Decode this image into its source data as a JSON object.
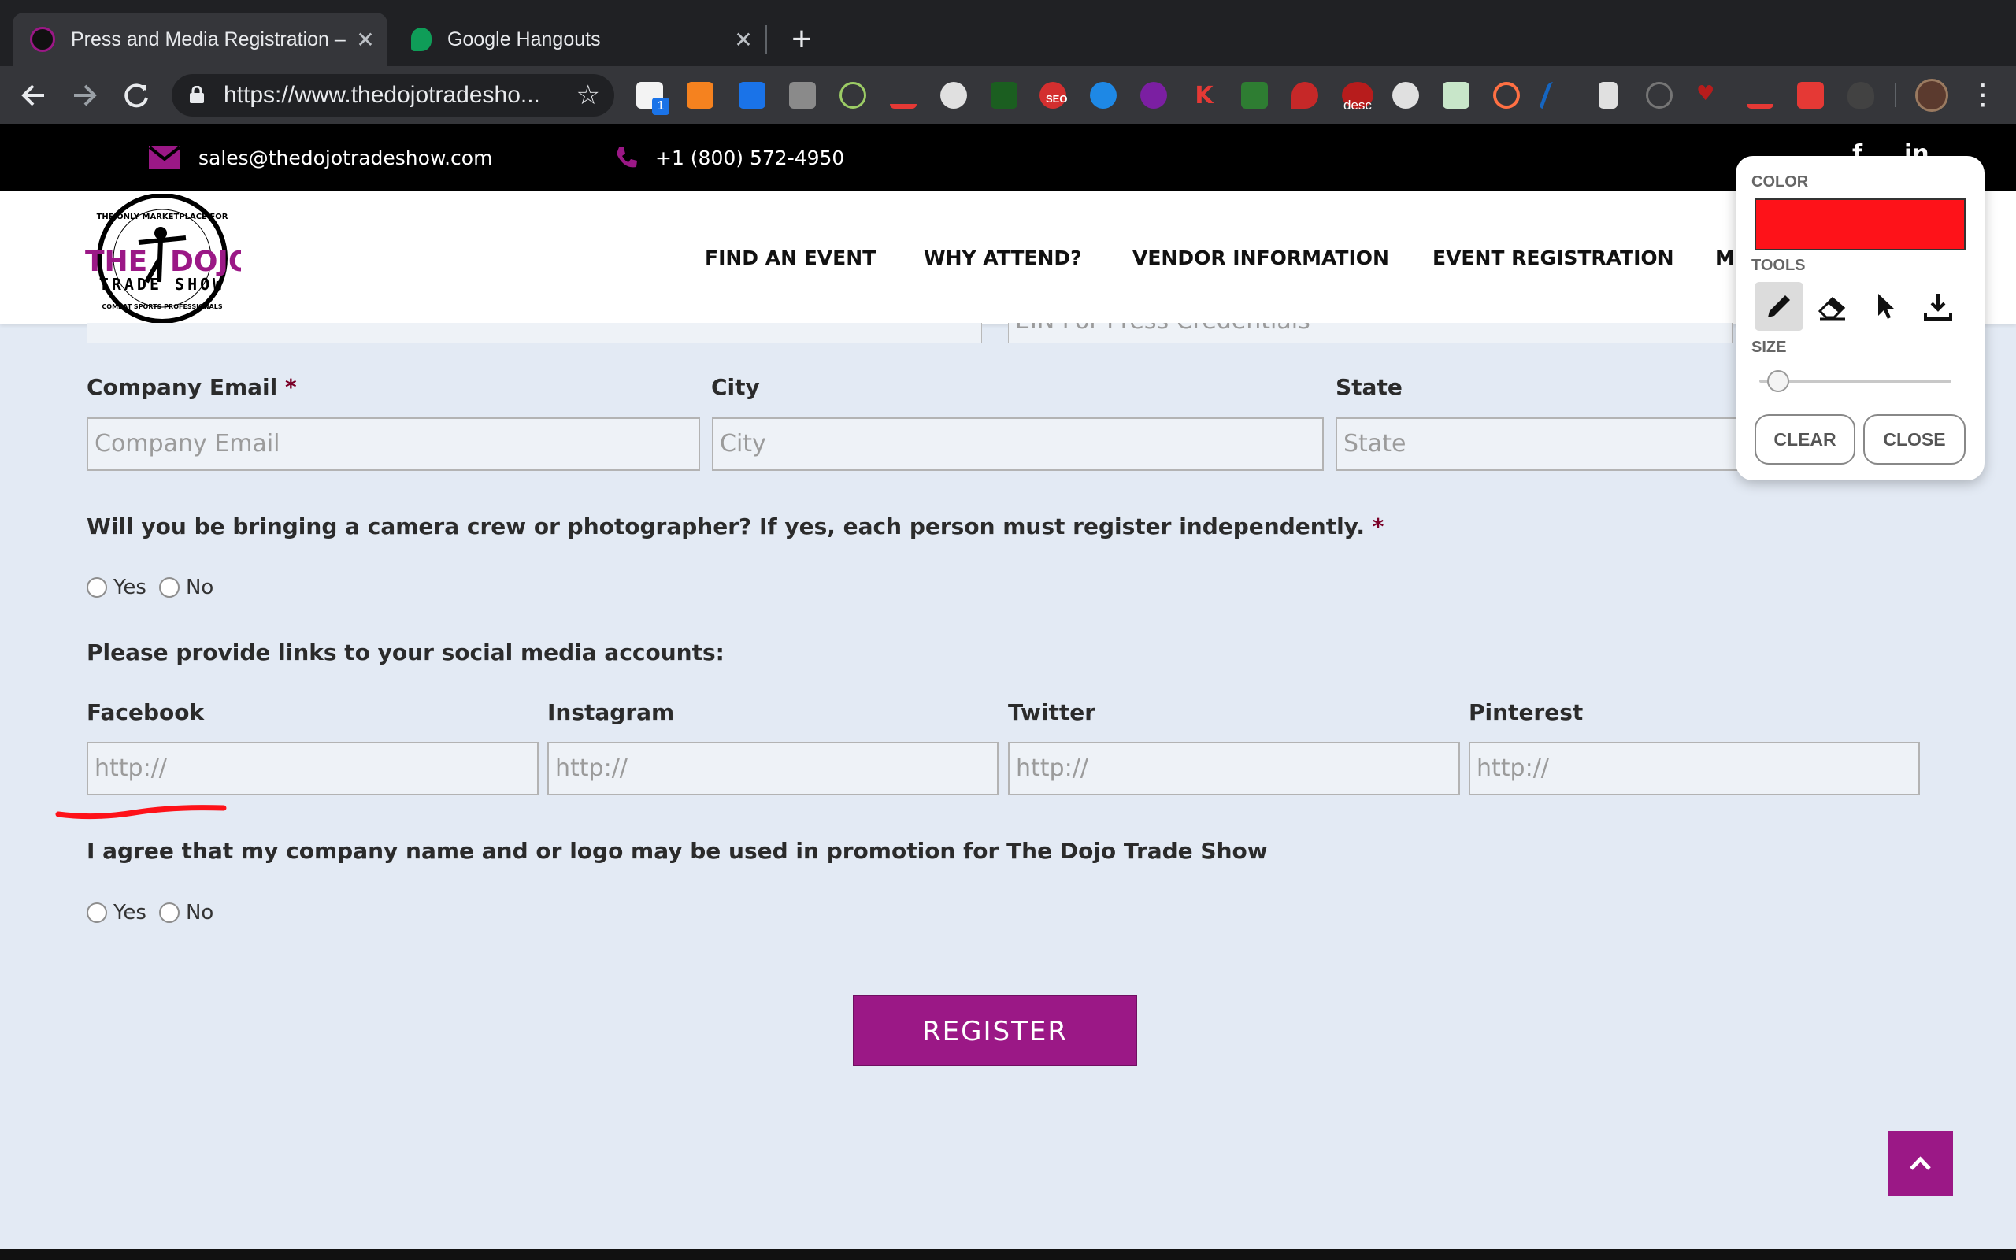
{
  "browser": {
    "tabs": [
      {
        "title": "Press and Media Registration –",
        "active": true
      },
      {
        "title": "Google Hangouts",
        "active": false
      }
    ],
    "close_glyph": "✕",
    "new_tab_glyph": "+",
    "url": "https://www.thedojotradesho...",
    "extension_badge_count": "1",
    "extension_badge_desc": "desc",
    "extension_badge_seo": "SEO"
  },
  "site": {
    "contact": {
      "email": "sales@thedojotradeshow.com",
      "phone": "+1 (800) 572-4950"
    },
    "logo": {
      "top_arc": "THE ONLY MARKETPLACE FOR",
      "bottom_arc": "COMBAT SPORTS PROFESSIONALS",
      "word_the": "THE",
      "word_dojo": "DOJO",
      "word_tradeshow": "TRADE SHOW"
    },
    "nav": [
      {
        "label": "FIND AN EVENT"
      },
      {
        "label": "WHY ATTEND?"
      },
      {
        "label": "VENDOR INFORMATION"
      },
      {
        "label": "EVENT REGISTRATION"
      },
      {
        "label": "MO"
      }
    ],
    "accent_color": "#9b1886"
  },
  "form": {
    "cut_field_text": "EIN For Press Credentials",
    "company_email": {
      "label": "Company Email",
      "required_mark": "*",
      "placeholder": "Company Email"
    },
    "city": {
      "label": "City",
      "placeholder": "City"
    },
    "state": {
      "label": "State",
      "placeholder": "State"
    },
    "camera_question": {
      "label": "Will you be bringing a camera crew or photographer? If yes, each person must register independently.",
      "required_mark": "*",
      "options": [
        "Yes",
        "No"
      ]
    },
    "social_heading": "Please provide links to your social media accounts:",
    "social": [
      {
        "label": "Facebook",
        "placeholder": "http://"
      },
      {
        "label": "Instagram",
        "placeholder": "http://"
      },
      {
        "label": "Twitter",
        "placeholder": "http://"
      },
      {
        "label": "Pinterest",
        "placeholder": "http://"
      }
    ],
    "agree_question": {
      "label": "I agree that my company name and or logo may be used in promotion for The Dojo Trade Show",
      "options": [
        "Yes",
        "No"
      ]
    },
    "register_label": "REGISTER"
  },
  "draw_panel": {
    "color_label": "COLOR",
    "color_value": "#fe1219",
    "tools_label": "TOOLS",
    "tools": [
      "pencil-icon",
      "eraser-icon",
      "pointer-icon",
      "download-icon"
    ],
    "selected_tool": "pencil-icon",
    "size_label": "SIZE",
    "size_level": 0.1,
    "clear_label": "CLEAR",
    "close_label": "CLOSE"
  }
}
